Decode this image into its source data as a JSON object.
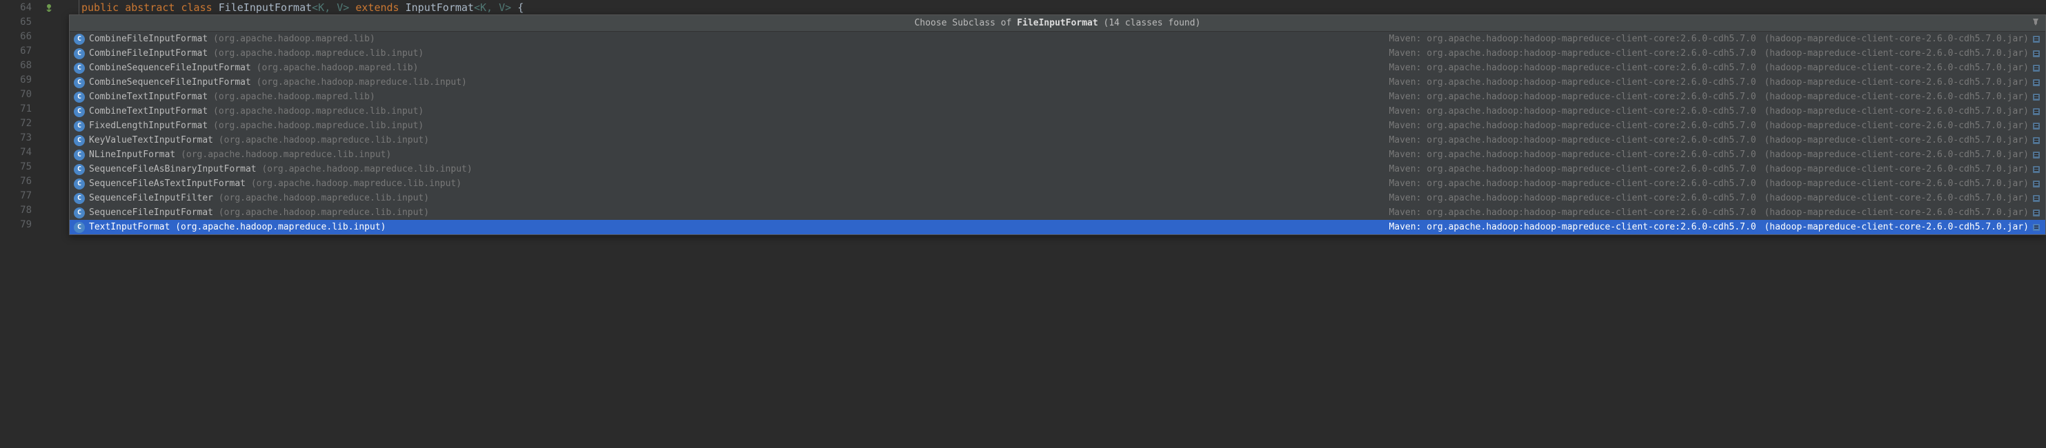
{
  "gutter_start": 64,
  "gutter_end": 79,
  "code_line": {
    "kw_public": "public",
    "kw_abstract": "abstract",
    "kw_class": "class",
    "classname": "FileInputFormat",
    "generic1": "<K, V>",
    "kw_extends": "extends",
    "supertype": "InputFormat",
    "generic2": "<K, V>",
    "brace": "{"
  },
  "popup": {
    "header_prefix": "Choose Subclass of ",
    "header_classname": "FileInputFormat",
    "header_suffix": " (14 classes found)",
    "maven_source": "Maven: org.apache.hadoop:hadoop-mapreduce-client-core:2.6.0-cdh5.7.0",
    "jar_name": "(hadoop-mapreduce-client-core-2.6.0-cdh5.7.0.jar)",
    "items": [
      {
        "class": "CombineFileInputFormat",
        "pkg": "(org.apache.hadoop.mapred.lib)",
        "selected": false
      },
      {
        "class": "CombineFileInputFormat",
        "pkg": "(org.apache.hadoop.mapreduce.lib.input)",
        "selected": false
      },
      {
        "class": "CombineSequenceFileInputFormat",
        "pkg": "(org.apache.hadoop.mapred.lib)",
        "selected": false
      },
      {
        "class": "CombineSequenceFileInputFormat",
        "pkg": "(org.apache.hadoop.mapreduce.lib.input)",
        "selected": false
      },
      {
        "class": "CombineTextInputFormat",
        "pkg": "(org.apache.hadoop.mapred.lib)",
        "selected": false
      },
      {
        "class": "CombineTextInputFormat",
        "pkg": "(org.apache.hadoop.mapreduce.lib.input)",
        "selected": false
      },
      {
        "class": "FixedLengthInputFormat",
        "pkg": "(org.apache.hadoop.mapreduce.lib.input)",
        "selected": false
      },
      {
        "class": "KeyValueTextInputFormat",
        "pkg": "(org.apache.hadoop.mapreduce.lib.input)",
        "selected": false
      },
      {
        "class": "NLineInputFormat",
        "pkg": "(org.apache.hadoop.mapreduce.lib.input)",
        "selected": false
      },
      {
        "class": "SequenceFileAsBinaryInputFormat",
        "pkg": "(org.apache.hadoop.mapreduce.lib.input)",
        "selected": false
      },
      {
        "class": "SequenceFileAsTextInputFormat",
        "pkg": "(org.apache.hadoop.mapreduce.lib.input)",
        "selected": false
      },
      {
        "class": "SequenceFileInputFilter",
        "pkg": "(org.apache.hadoop.mapreduce.lib.input)",
        "selected": false
      },
      {
        "class": "SequenceFileInputFormat",
        "pkg": "(org.apache.hadoop.mapreduce.lib.input)",
        "selected": false
      },
      {
        "class": "TextInputFormat",
        "pkg": "(org.apache.hadoop.mapreduce.lib.input)",
        "selected": true
      }
    ]
  },
  "icons": {
    "class_letter": "C",
    "pin": "📌"
  }
}
